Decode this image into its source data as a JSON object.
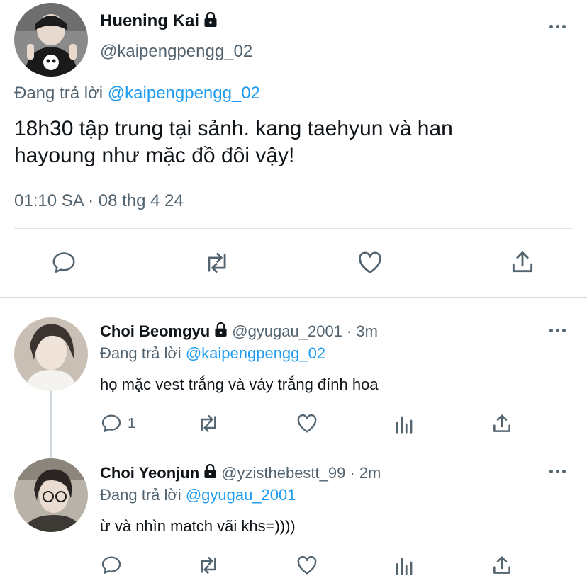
{
  "main_tweet": {
    "author_name": "Huening Kai",
    "handle": "@kaipengpengg_02",
    "replying_prefix": "Đang trả lời",
    "replying_to": "@kaipengpengg_02",
    "text_line1": "18h30 tập trung tại sảnh. kang taehyun và han",
    "text_line2": "hayoung như mặc đồ đôi vậy!",
    "timestamp": "01:10 SA · 08 thg 4 24",
    "icons": [
      "reply-icon",
      "retweet-icon",
      "like-icon",
      "share-icon"
    ]
  },
  "replies": [
    {
      "author_name": "Choi Beomgyu",
      "handle": "@gyugau_2001",
      "time": "· 3m",
      "replying_prefix": "Đang trả lời",
      "replying_to": "@kaipengpengg_02",
      "text": "họ mặc vest trắng và váy trắng đính hoa",
      "reply_count": "1"
    },
    {
      "author_name": "Choi Yeonjun",
      "handle": "@yzisthebestt_99",
      "time": "· 2m",
      "replying_prefix": "Đang trả lời",
      "replying_to": "@gyugau_2001",
      "text": "ừ và nhìn match vãi khs=))))",
      "reply_count": ""
    }
  ],
  "colors": {
    "accent": "#1d9bf0",
    "secondary_text": "#536471",
    "divider": "#e1e6ea"
  }
}
